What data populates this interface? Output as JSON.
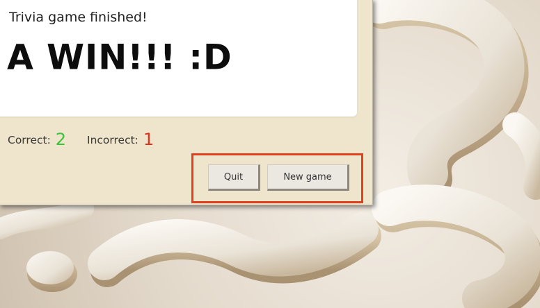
{
  "card": {
    "subtitle": "Trivia game finished!",
    "title": "A WIN!!! :D"
  },
  "score": {
    "correct_label": "Correct:",
    "correct_value": "2",
    "incorrect_label": "Incorrect:",
    "incorrect_value": "1"
  },
  "buttons": {
    "quit_label": "Quit",
    "new_game_label": "New game"
  },
  "colors": {
    "correct": "#3ac23a",
    "incorrect": "#e0331b",
    "highlight": "#e0401c",
    "panel": "#efe4cc"
  }
}
